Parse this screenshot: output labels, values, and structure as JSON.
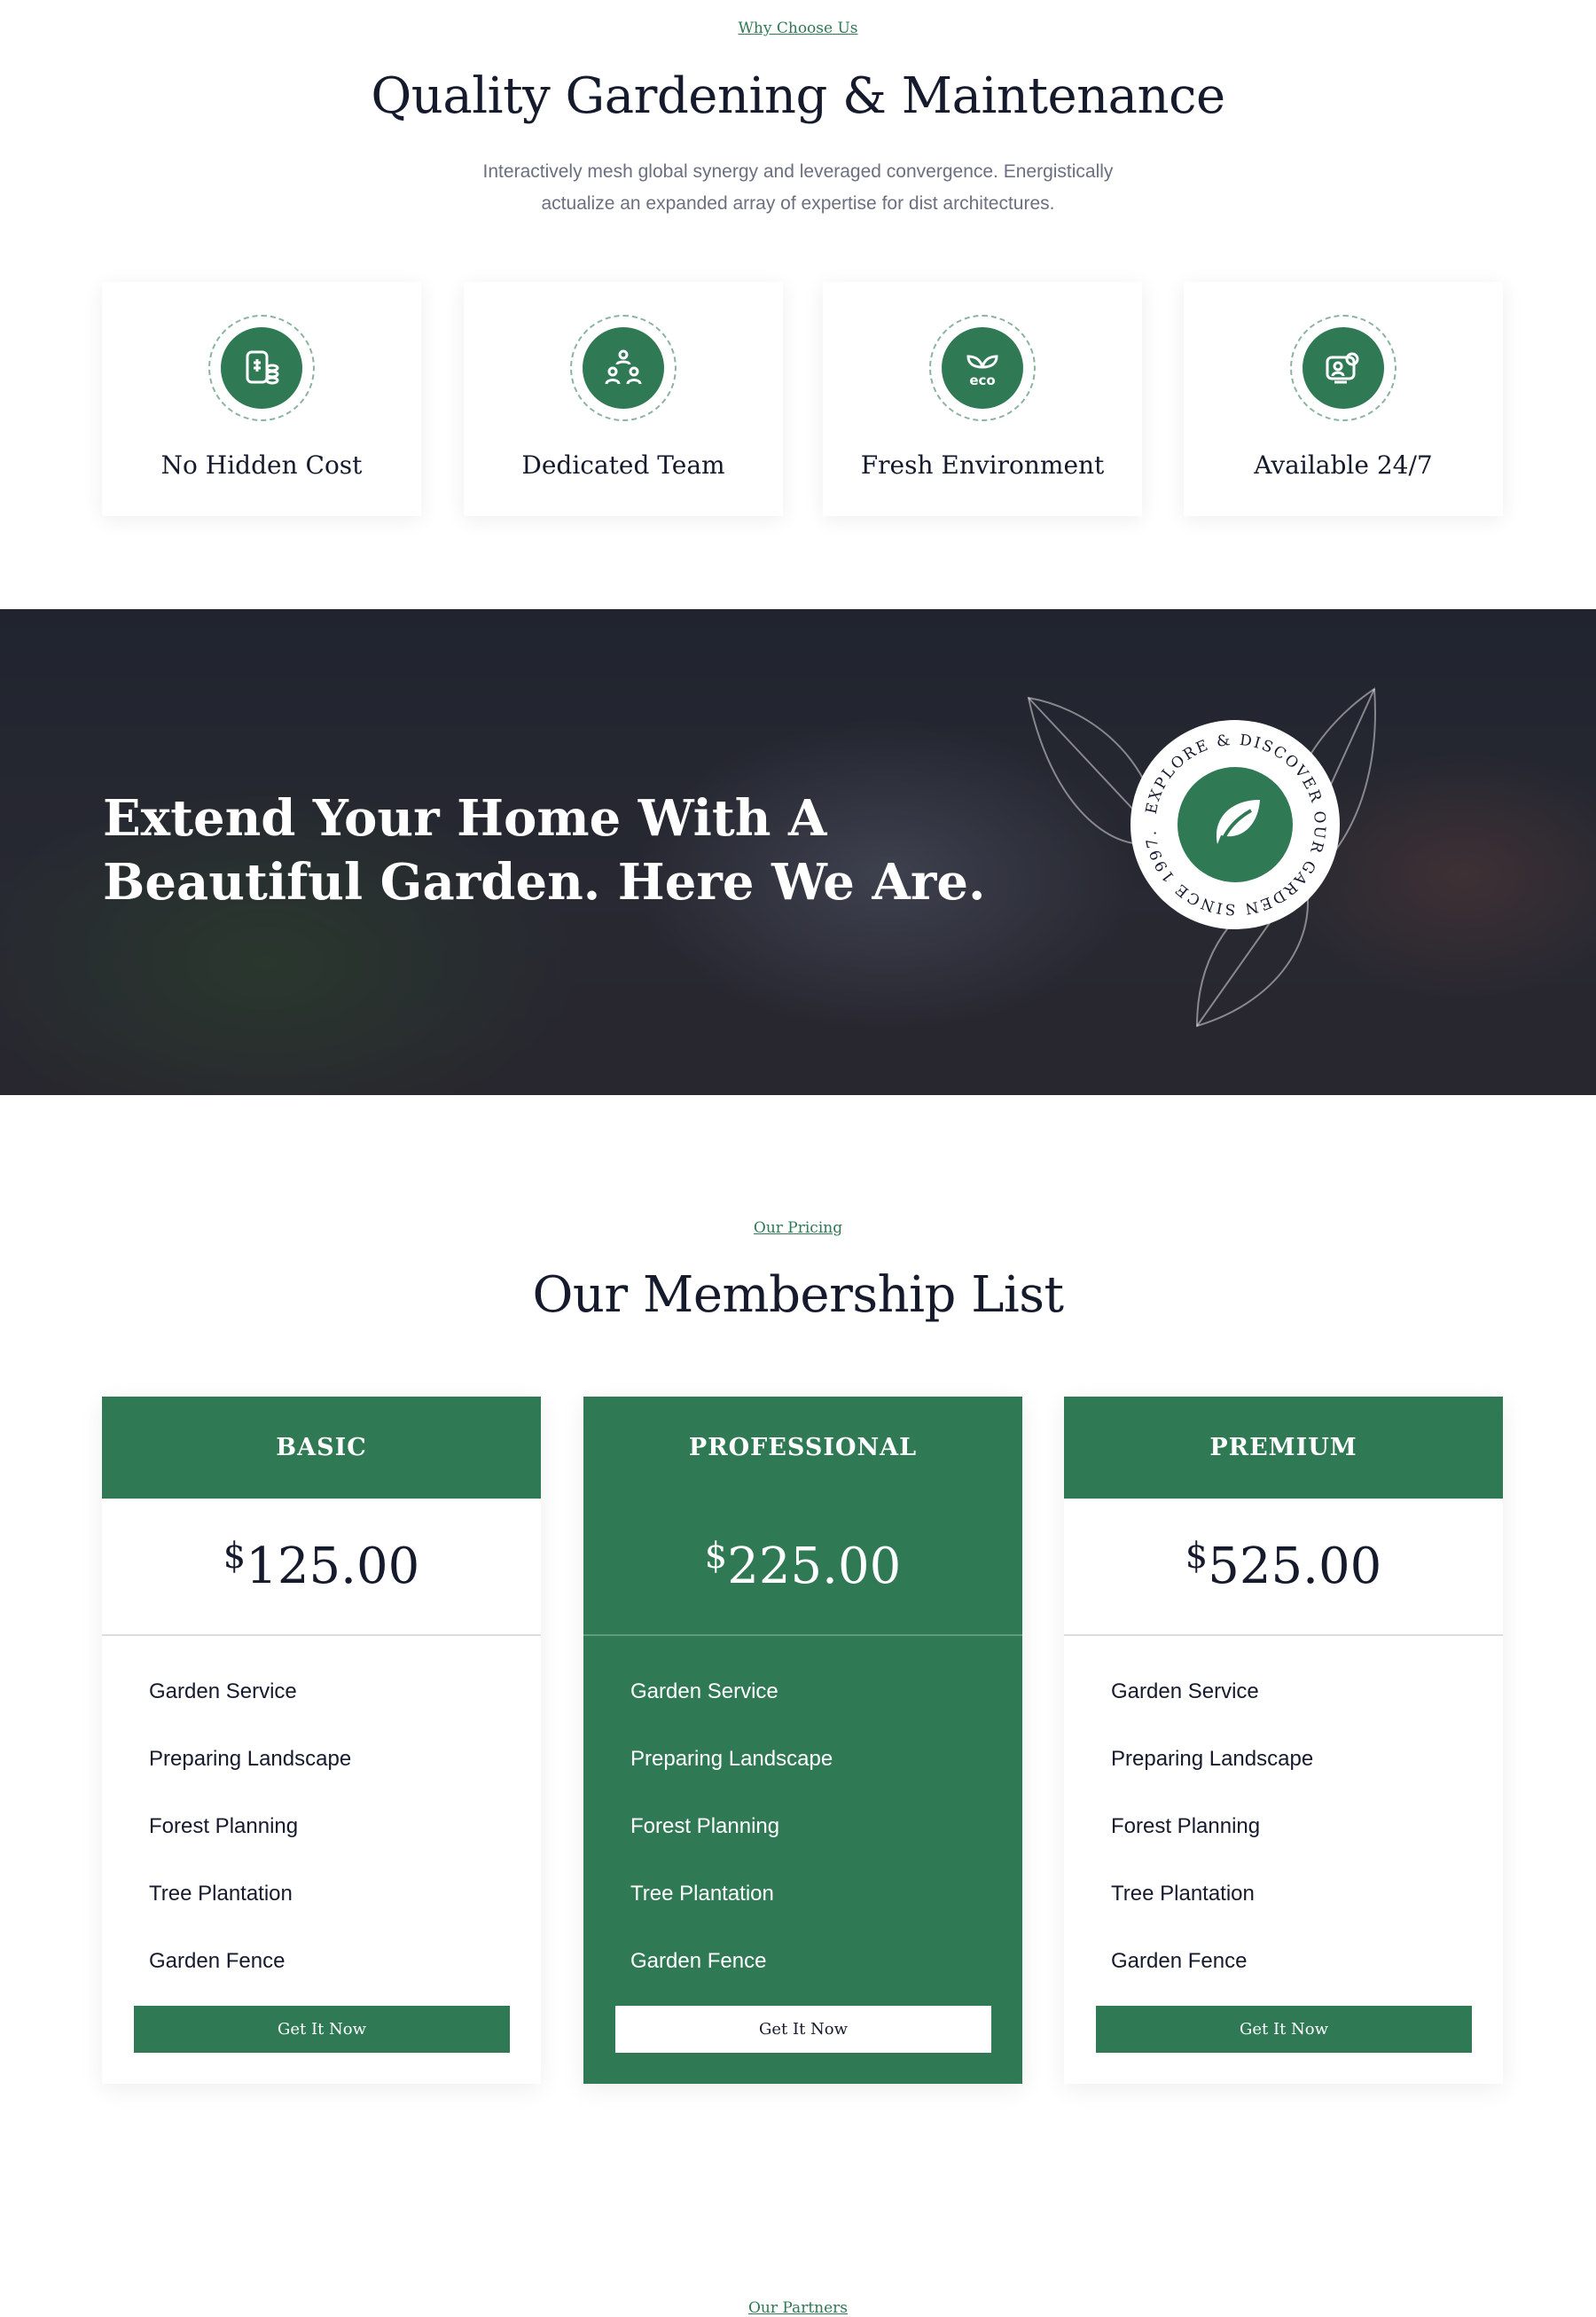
{
  "why": {
    "eyebrow": "Why Choose Us",
    "title": "Quality Gardening & Maintenance",
    "subtitle_line1": "Interactively mesh global synergy and leveraged convergence. Energistically",
    "subtitle_line2": "actualize an expanded array of expertise for dist architectures.",
    "features": [
      {
        "label": "No Hidden Cost",
        "icon": "money-document-icon"
      },
      {
        "label": "Dedicated Team",
        "icon": "team-icon"
      },
      {
        "label": "Fresh Environment",
        "icon": "eco-leaf-icon"
      },
      {
        "label": "Available 24/7",
        "icon": "support-screen-icon"
      }
    ]
  },
  "hero": {
    "line1": "Extend Your Home With A",
    "line2": "Beautiful Garden. Here We Are.",
    "badge_text": "EXPLORE & DISCOVER OUR GARDEN SINCE 1997.",
    "badge_icon": "leaf-icon"
  },
  "pricing": {
    "eyebrow": "Our Pricing",
    "title": "Our Membership List",
    "currency": "$",
    "plans": [
      {
        "name": "BASIC",
        "price": "125.00",
        "button": "Get It Now"
      },
      {
        "name": "PROFESSIONAL",
        "price": "225.00",
        "button": "Get It Now"
      },
      {
        "name": "PREMIUM",
        "price": "525.00",
        "button": "Get It Now"
      }
    ],
    "features": [
      "Garden Service",
      "Preparing Landscape",
      "Forest Planning",
      "Tree Plantation",
      "Garden Fence"
    ]
  },
  "partners": {
    "eyebrow": "Our Partners"
  },
  "colors": {
    "brand_green": "#2f7a55",
    "heading": "#161a2d"
  }
}
